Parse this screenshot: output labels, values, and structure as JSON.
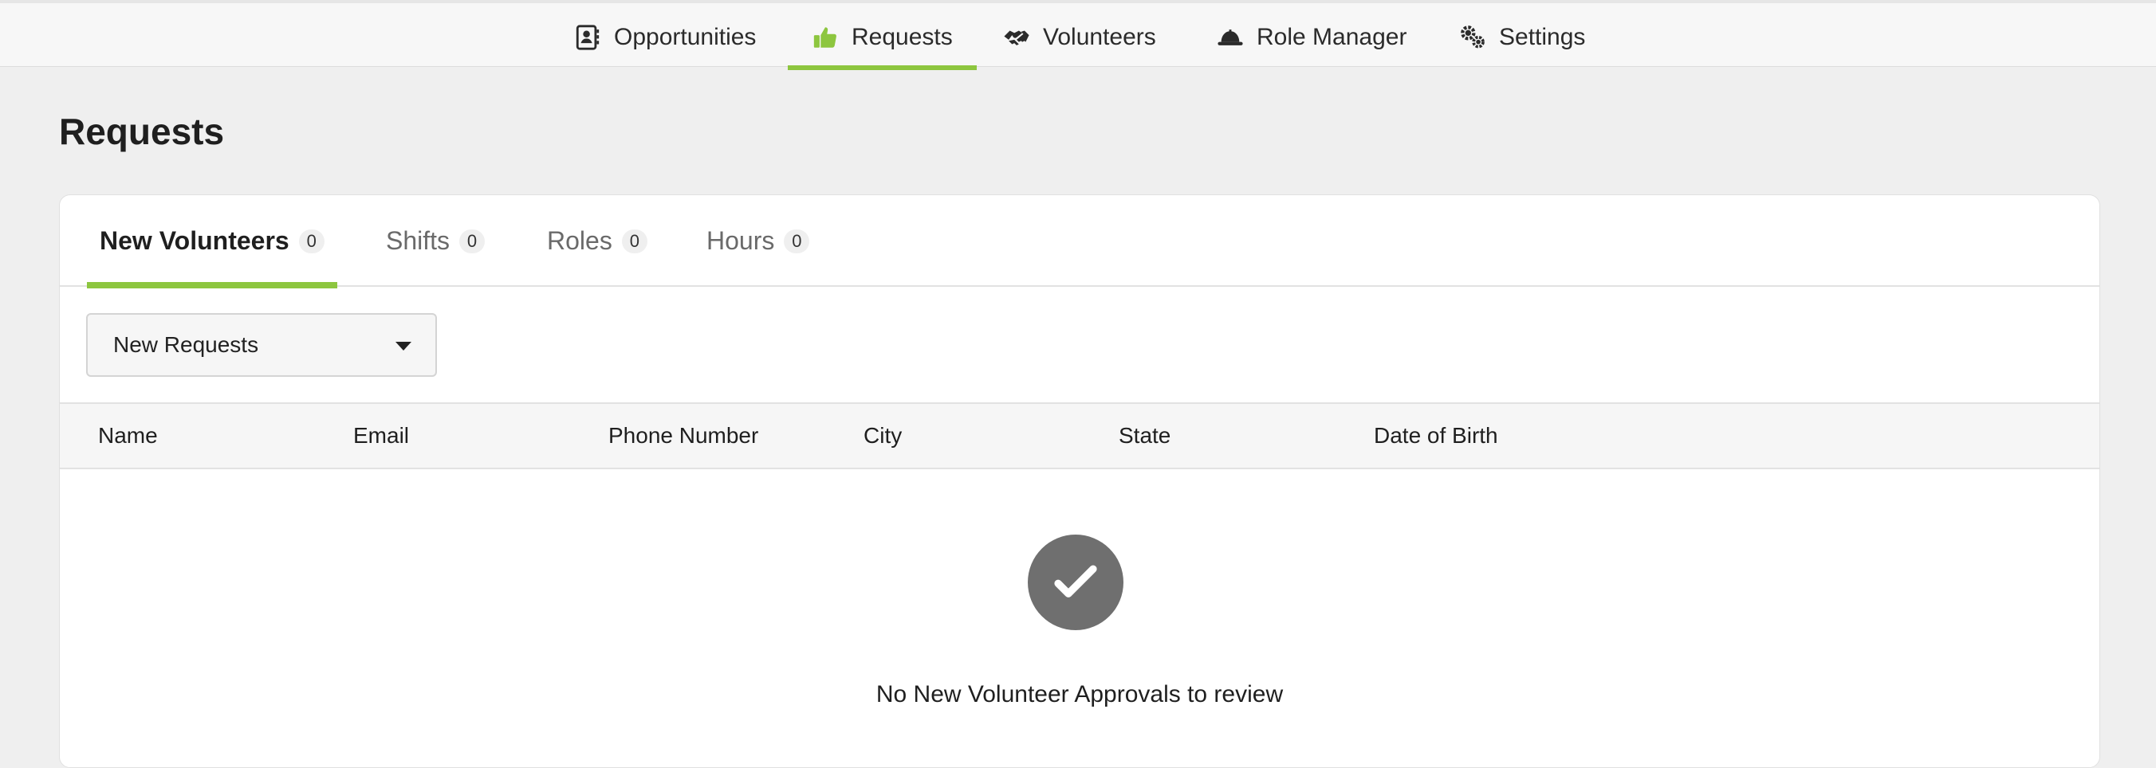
{
  "nav": {
    "items": [
      {
        "label": "Opportunities",
        "icon": "contact-book-icon"
      },
      {
        "label": "Requests",
        "icon": "thumbs-up-icon",
        "active": true
      },
      {
        "label": "Volunteers",
        "icon": "handshake-icon"
      },
      {
        "label": "Role Manager",
        "icon": "hard-hat-icon"
      },
      {
        "label": "Settings",
        "icon": "gears-icon"
      }
    ]
  },
  "page": {
    "title": "Requests"
  },
  "tabs": [
    {
      "label": "New Volunteers",
      "count": "0",
      "active": true
    },
    {
      "label": "Shifts",
      "count": "0"
    },
    {
      "label": "Roles",
      "count": "0"
    },
    {
      "label": "Hours",
      "count": "0"
    }
  ],
  "filter": {
    "selected": "New Requests"
  },
  "table": {
    "columns": [
      "Name",
      "Email",
      "Phone Number",
      "City",
      "State",
      "Date of Birth"
    ]
  },
  "empty_state": {
    "message": "No New Volunteer Approvals to review",
    "icon": "check-circle-icon"
  },
  "colors": {
    "accent": "#8dc63f",
    "background": "#efefef",
    "empty_icon": "#6f6f6f"
  }
}
